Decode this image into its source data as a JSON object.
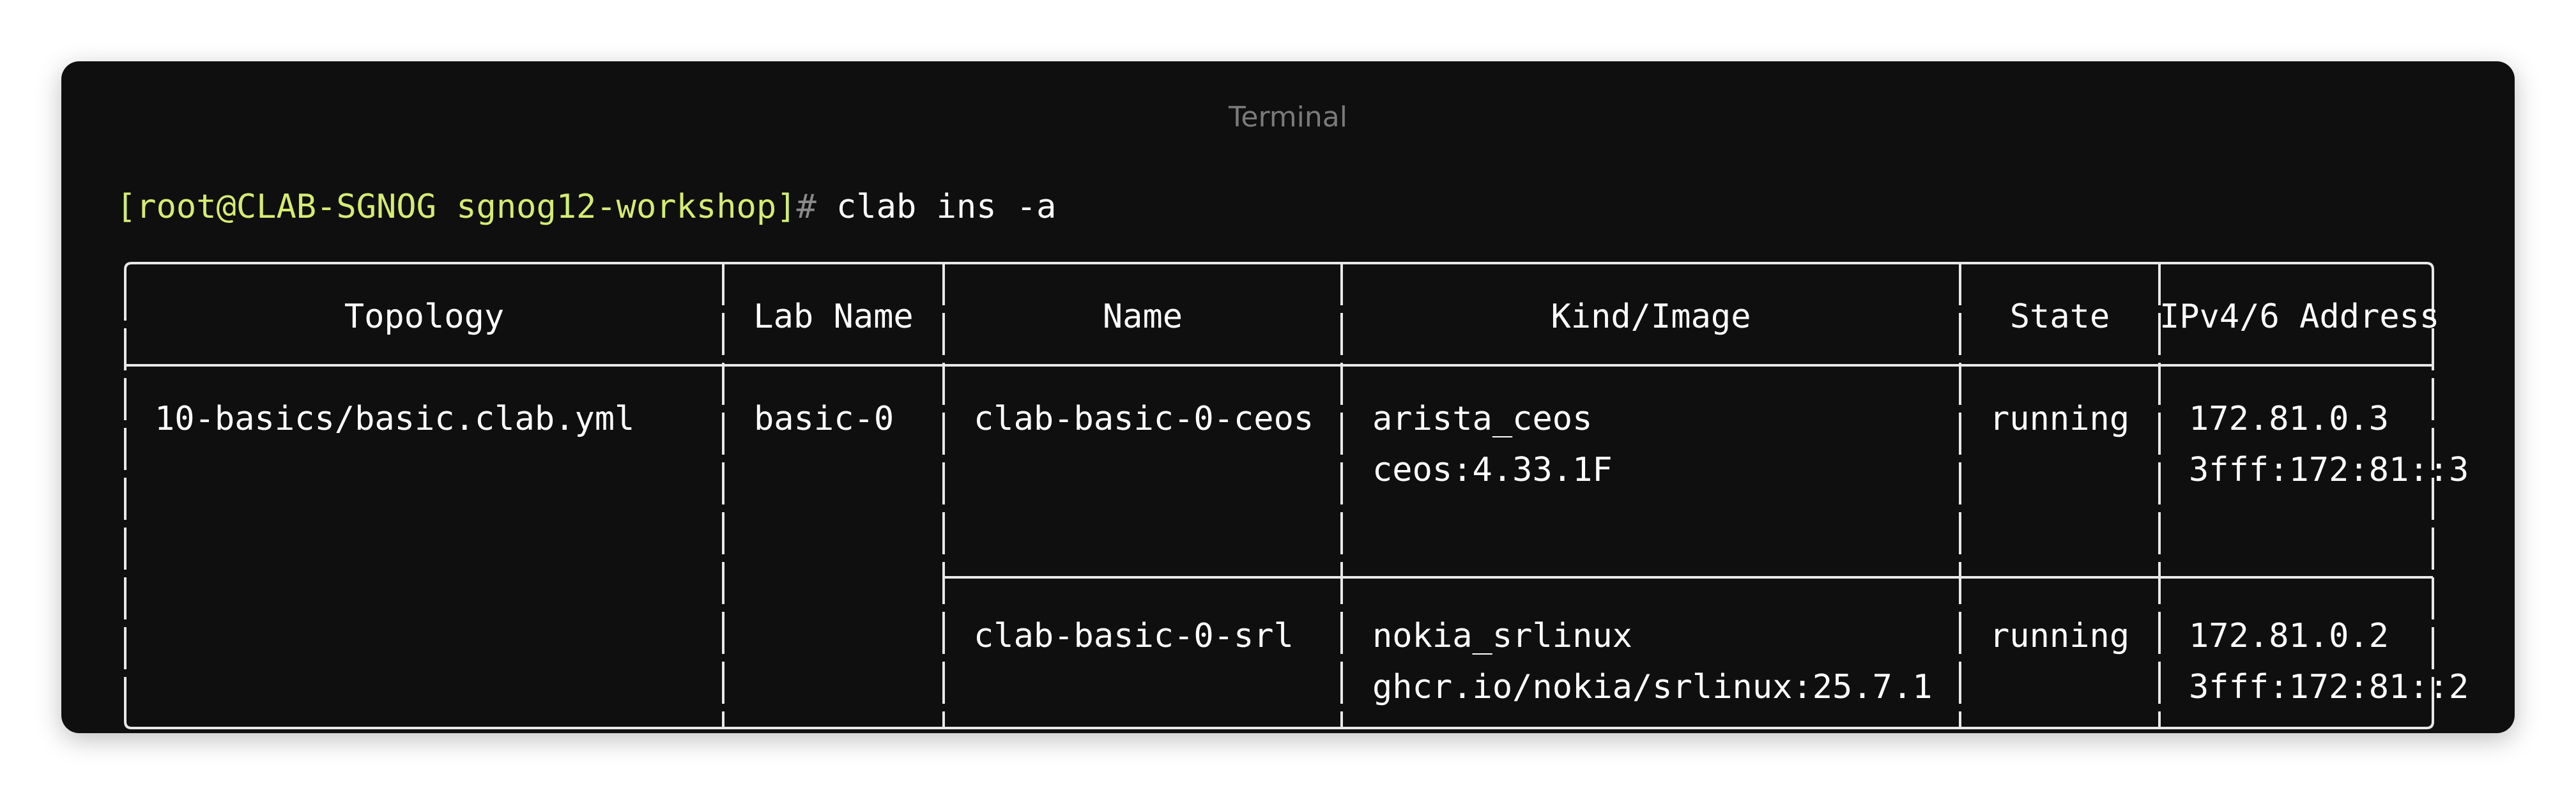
{
  "window": {
    "title": "Terminal"
  },
  "command": {
    "prompt": "[root@CLAB-SGNOG sgnog12-workshop]",
    "hash": "#",
    "text": " clab ins -a"
  },
  "table": {
    "headers": [
      "Topology",
      "Lab Name",
      "Name",
      "Kind/Image",
      "State",
      "IPv4/6 Address"
    ],
    "topology": "10-basics/basic.clab.yml",
    "lab_name": "basic-0",
    "rows": [
      {
        "name": "clab-basic-0-ceos",
        "kind": "arista_ceos",
        "image": "ceos:4.33.1F",
        "state": "running",
        "ipv4": "172.81.0.3",
        "ipv6": "3fff:172:81::3"
      },
      {
        "name": "clab-basic-0-srl",
        "kind": "nokia_srlinux",
        "image": "ghcr.io/nokia/srlinux:25.7.1",
        "state": "running",
        "ipv4": "172.81.0.2",
        "ipv6": "3fff:172:81::2"
      }
    ]
  }
}
